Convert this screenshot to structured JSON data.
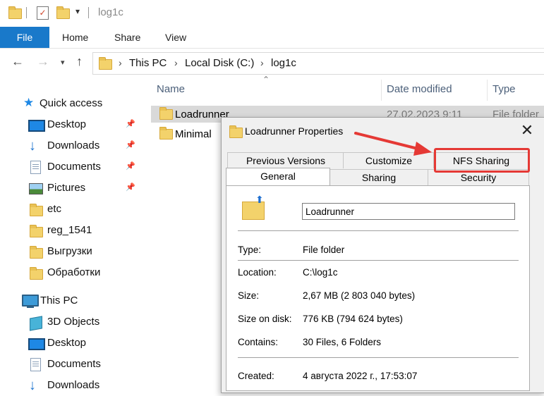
{
  "window": {
    "title": "log1c"
  },
  "ribbon": {
    "tabs": [
      "File",
      "Home",
      "Share",
      "View"
    ]
  },
  "address": {
    "crumbs": [
      "This PC",
      "Local Disk (C:)",
      "log1c"
    ]
  },
  "navpane": {
    "quick_access_label": "Quick access",
    "quick_items": [
      {
        "label": "Desktop",
        "icon": "desktop-icon",
        "pinned": true
      },
      {
        "label": "Downloads",
        "icon": "downloads-icon",
        "pinned": true
      },
      {
        "label": "Documents",
        "icon": "documents-icon",
        "pinned": true
      },
      {
        "label": "Pictures",
        "icon": "pictures-icon",
        "pinned": true
      },
      {
        "label": "etc",
        "icon": "folder-icon"
      },
      {
        "label": "reg_1541",
        "icon": "folder-icon"
      },
      {
        "label": "Выгрузки",
        "icon": "folder-icon"
      },
      {
        "label": "Обработки",
        "icon": "folder-icon"
      }
    ],
    "this_pc_label": "This PC",
    "pc_items": [
      {
        "label": "3D Objects",
        "icon": "3d-objects-icon"
      },
      {
        "label": "Desktop",
        "icon": "desktop-icon"
      },
      {
        "label": "Documents",
        "icon": "documents-icon"
      },
      {
        "label": "Downloads",
        "icon": "downloads-icon"
      }
    ]
  },
  "content": {
    "columns": [
      "Name",
      "Date modified",
      "Type"
    ],
    "rows": [
      {
        "name": "Loadrunner",
        "date": "27.02.2023 9:11",
        "type": "File folder",
        "selected": true
      },
      {
        "name": "Minimal",
        "date": "",
        "type": ""
      }
    ]
  },
  "dialog": {
    "title": "Loadrunner Properties",
    "tabs_back": [
      "Previous Versions",
      "Customize",
      "NFS Sharing"
    ],
    "tabs_front": [
      "General",
      "Sharing",
      "Security"
    ],
    "active_tab": "General",
    "name_value": "Loadrunner",
    "props": [
      {
        "label": "Type:",
        "value": "File folder"
      },
      {
        "label": "Location:",
        "value": "C:\\log1c"
      },
      {
        "label": "Size:",
        "value": "2,67 MB (2 803 040 bytes)"
      },
      {
        "label": "Size on disk:",
        "value": "776 KB (794 624 bytes)"
      },
      {
        "label": "Contains:",
        "value": "30 Files, 6 Folders"
      },
      {
        "label": "Created:",
        "value": "4 августа 2022 г., 17:53:07"
      }
    ]
  },
  "annotation": {
    "highlight_color": "#e53935",
    "target": "NFS Sharing"
  }
}
